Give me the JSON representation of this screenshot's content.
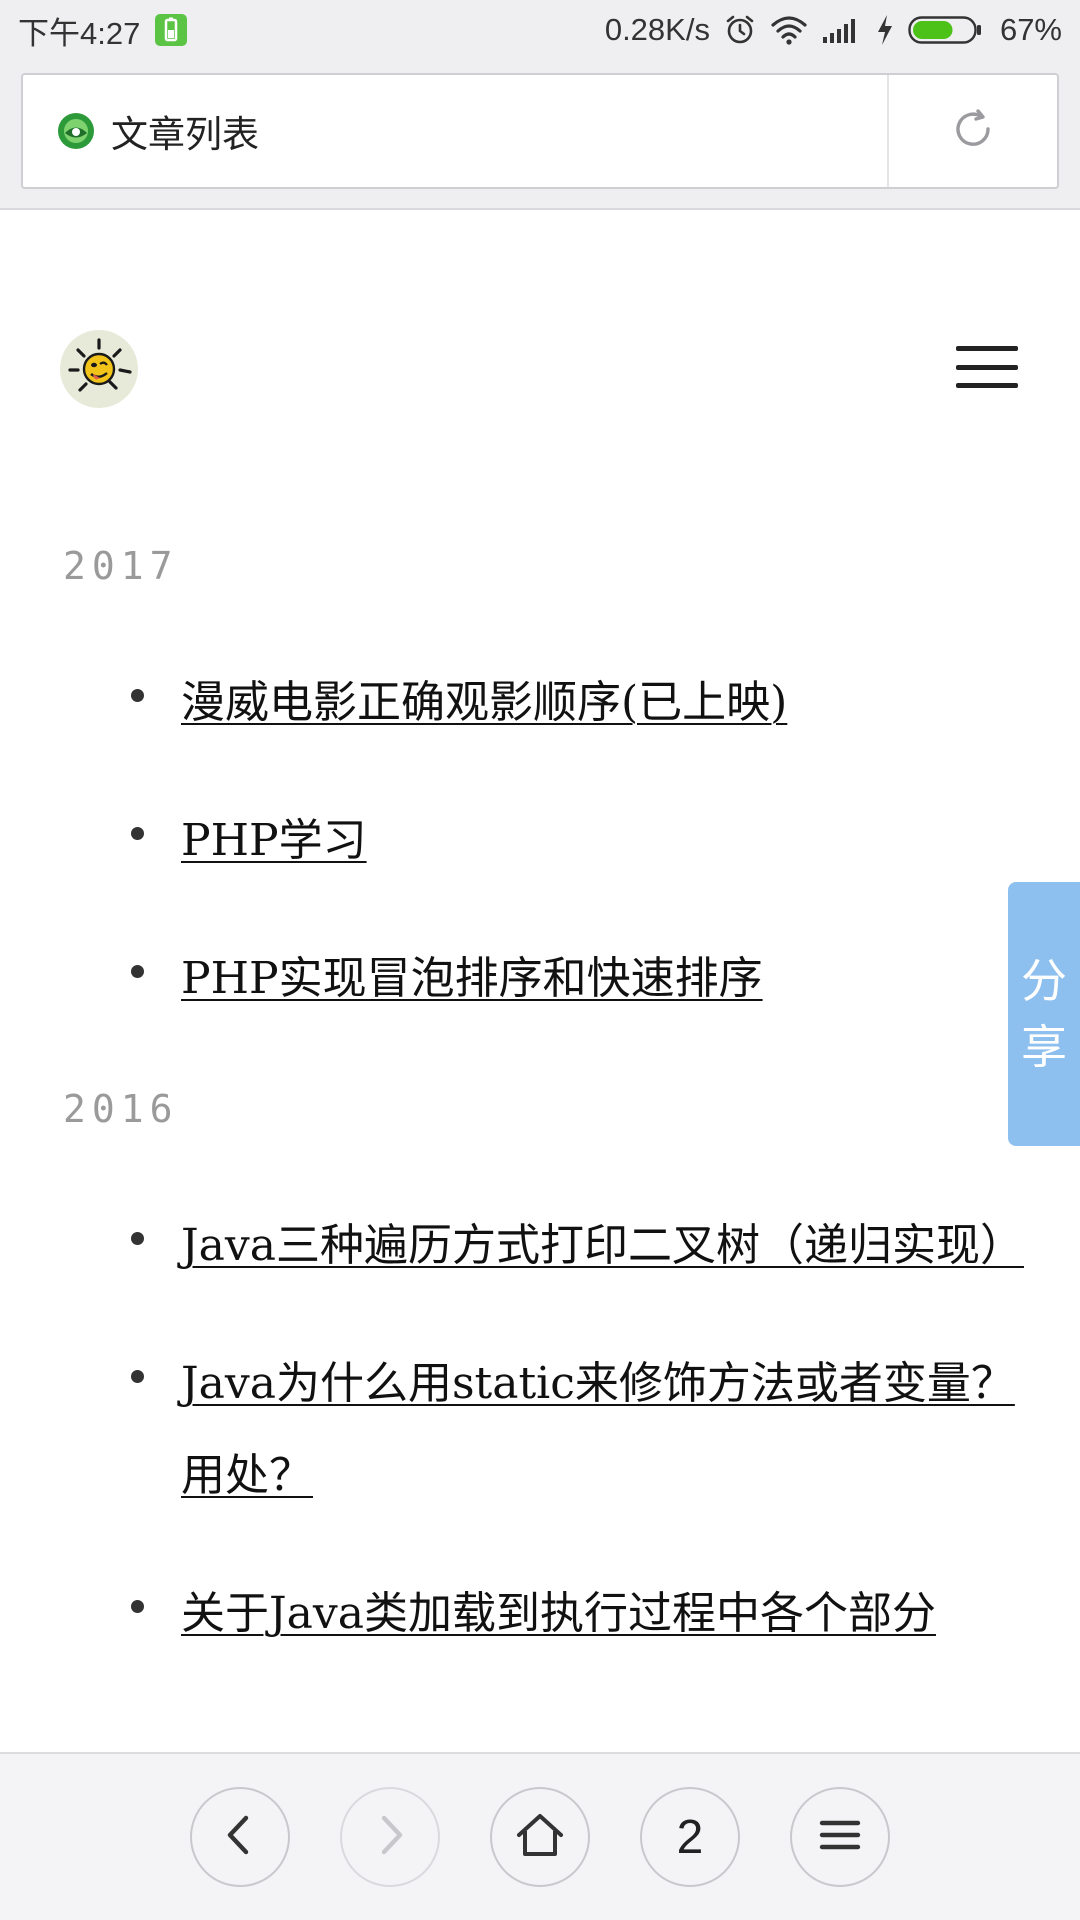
{
  "status_bar": {
    "time": "下午4:27",
    "net_speed": "0.28K/s",
    "battery_percent": "67%",
    "battery_level": 0.67,
    "icons": [
      "battery-saver-icon",
      "alarm-icon",
      "wifi-icon",
      "signal-icon",
      "charging-icon",
      "battery-icon"
    ]
  },
  "address_bar": {
    "title": "文章列表",
    "site_icon": "site-favicon-icon",
    "reload_icon": "reload-icon"
  },
  "page": {
    "logo": "site-logo-icon",
    "menu_icon": "hamburger-menu-icon",
    "sections": [
      {
        "year": "2017",
        "posts": [
          "漫威电影正确观影顺序(已上映)",
          "PHP学习",
          "PHP实现冒泡排序和快速排序"
        ]
      },
      {
        "year": "2016",
        "posts": [
          "Java三种遍历方式打印二叉树（递归实现）",
          "Java为什么用static来修饰方法或者变量？用处？",
          "关于Java类加载到执行过程中各个部分"
        ]
      }
    ]
  },
  "share_tab": {
    "label_line1": "分",
    "label_line2": "享"
  },
  "bottom_nav": {
    "back_icon": "back-icon",
    "forward_icon": "forward-icon",
    "home_icon": "home-icon",
    "tab_count": "2",
    "menu_icon": "menu-icon"
  },
  "colors": {
    "share_tab": "#8ec0ef",
    "year_heading": "#9a9a9a",
    "battery_fill": "#4cc219",
    "chrome_bg": "#efeff1"
  }
}
